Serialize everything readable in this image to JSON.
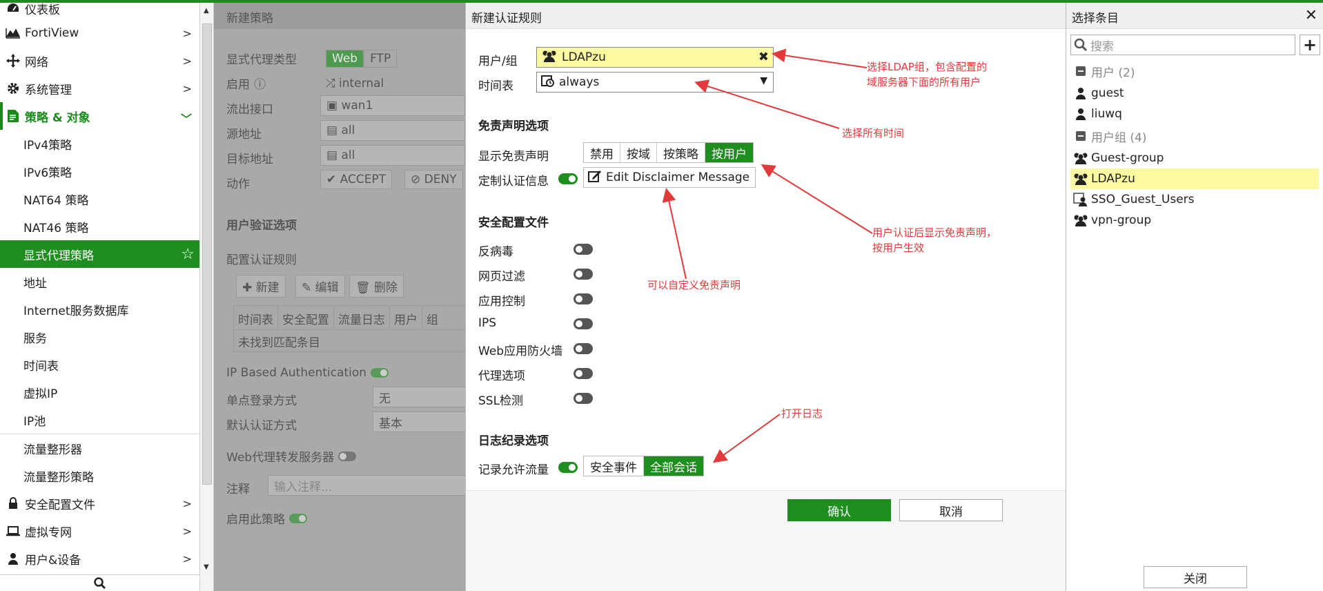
{
  "sidebar": {
    "items": [
      {
        "label": "仪表板",
        "icon": "dashboard-icon"
      },
      {
        "label": "FortiView",
        "icon": "chart-icon"
      },
      {
        "label": "网络",
        "icon": "network-icon"
      },
      {
        "label": "系统管理",
        "icon": "gear-icon"
      },
      {
        "label": "策略 & 对象",
        "icon": "policy-icon"
      },
      {
        "label": "IPv4策略"
      },
      {
        "label": "IPv6策略"
      },
      {
        "label": "NAT64 策略"
      },
      {
        "label": "NAT46 策略"
      },
      {
        "label": "显式代理策略"
      },
      {
        "label": "地址"
      },
      {
        "label": "Internet服务数据库"
      },
      {
        "label": "服务"
      },
      {
        "label": "时间表"
      },
      {
        "label": "虚拟IP"
      },
      {
        "label": "IP池"
      },
      {
        "label": "流量整形器"
      },
      {
        "label": "流量整形策略"
      },
      {
        "label": "安全配置文件",
        "icon": "lock-icon"
      },
      {
        "label": "虚拟专网",
        "icon": "laptop-icon"
      },
      {
        "label": "用户&设备",
        "icon": "user-icon"
      }
    ]
  },
  "bg": {
    "title": "新建策略",
    "proxy_type_label": "显式代理类型",
    "proxy_web": "Web",
    "proxy_ftp": "FTP",
    "enable_label": "启用",
    "enable_value": "internal",
    "out_if_label": "流出接口",
    "out_if_value": "wan1",
    "src_label": "源地址",
    "src_value": "all",
    "dst_label": "目标地址",
    "dst_value": "all",
    "action_label": "动作",
    "accept": "ACCEPT",
    "deny": "DENY",
    "auth_opts": "用户验证选项",
    "cfg_rules": "配置认证规则",
    "btn_new": "新建",
    "btn_edit": "编辑",
    "btn_del": "删除",
    "cols": [
      "时间表",
      "安全配置",
      "流量日志",
      "用户",
      "组"
    ],
    "empty": "未找到匹配条目",
    "ip_auth": "IP Based Authentication",
    "sso_label": "单点登录方式",
    "sso_value": "无",
    "default_auth_label": "默认认证方式",
    "default_auth_value": "基本",
    "web_fwd": "Web代理转发服务器",
    "note_label": "注释",
    "note_placeholder": "输入注释...",
    "enable_policy": "启用此策略"
  },
  "dialog": {
    "title": "新建认证规则",
    "user_group_label": "用户/组",
    "user_group_value": "LDAPzu",
    "schedule_label": "时间表",
    "schedule_value": "always",
    "disclaimer_section": "免责声明选项",
    "show_disclaimer_label": "显示免责声明",
    "disclaimer_options": [
      "禁用",
      "按域",
      "按策略",
      "按用户"
    ],
    "disclaimer_selected": "按用户",
    "custom_msg_label": "定制认证信息",
    "edit_msg_button": "Edit Disclaimer Message",
    "security_section": "安全配置文件",
    "profiles": [
      "反病毒",
      "网页过滤",
      "应用控制",
      "IPS",
      "Web应用防火墙",
      "代理选项",
      "SSL检测"
    ],
    "log_section": "日志纪录选项",
    "log_allowed_label": "记录允许流量",
    "log_options": [
      "安全事件",
      "全部会话"
    ],
    "log_selected": "全部会话",
    "ok": "确认",
    "cancel": "取消"
  },
  "right": {
    "title": "选择条目",
    "search_placeholder": "搜索",
    "users_header": "用户 (2)",
    "users": [
      "guest",
      "liuwq"
    ],
    "groups_header": "用户组 (4)",
    "groups": [
      "Guest-group",
      "LDAPzu",
      "SSO_Guest_Users",
      "vpn-group"
    ],
    "selected": "LDAPzu",
    "close": "关闭"
  },
  "annotations": {
    "a1": "选择LDAP组，包含配置的\n域服务器下面的所有用户",
    "a2": "选择所有时间",
    "a3": "用户认证后显示免责声明，\n按用户生效",
    "a4": "可以自定义免责声明",
    "a5": "打开日志"
  },
  "colors": {
    "accent": "#1e8e1e",
    "highlight": "#fbfaa2",
    "annotation": "#e23a3a"
  }
}
